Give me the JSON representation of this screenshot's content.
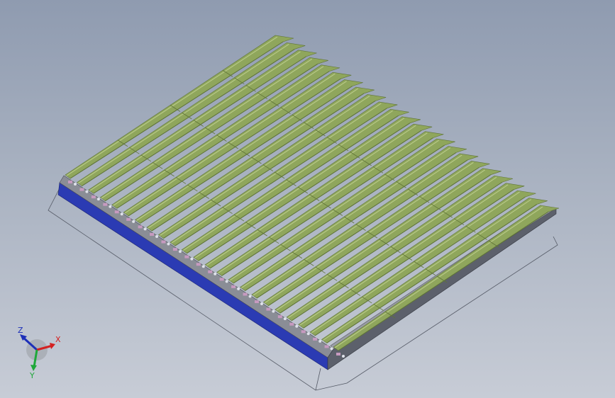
{
  "viewport": {
    "background_top": "#8f9bb0",
    "background_bottom": "#c7ccd6"
  },
  "model": {
    "rail_count": 24,
    "rail_color": "#8fa65c",
    "rail_highlight": "#b7c986",
    "rail_shadow": "#5f7438",
    "frame_top_color": "#8a8d96",
    "frame_side_color": "#2b3bb3",
    "frame_dark_color": "#3d4048",
    "bracket_color": "#c79ac0",
    "bounding_box_color": "#555a66"
  },
  "triad": {
    "x_label": "X",
    "y_label": "Y",
    "z_label": "Z",
    "x_color": "#d42020",
    "y_color": "#1fa83a",
    "z_color": "#1d2fb8"
  }
}
